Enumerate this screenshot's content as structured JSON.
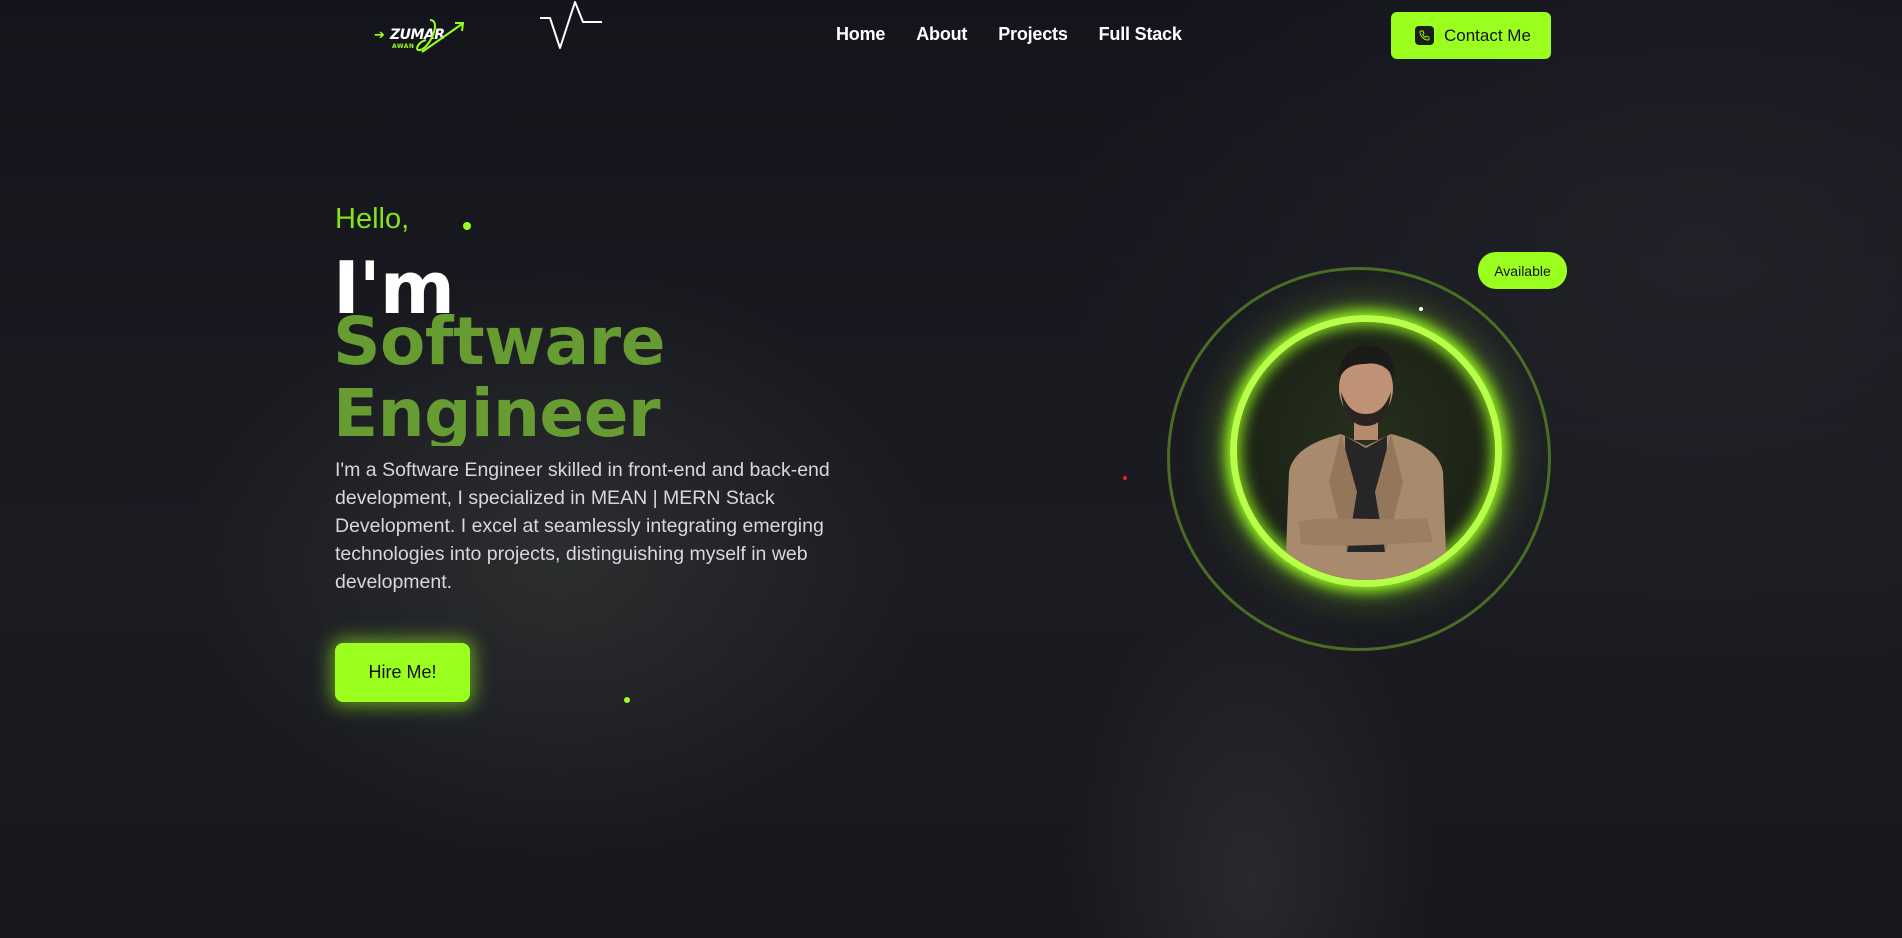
{
  "nav": {
    "logo": {
      "brand": "ZUMAR",
      "sub": "AWAN"
    },
    "menu": [
      "Home",
      "About",
      "Projects",
      "Full Stack"
    ],
    "contact_label": "Contact Me"
  },
  "hero": {
    "greeting": "Hello,",
    "intro": "I'm",
    "role_line1": "Software",
    "role_line2": "Engineer",
    "bio": "I'm a Software Engineer skilled in front-end and back-end development, I specialized in MEAN | MERN Stack Development. I excel at seamlessly integrating emerging technologies into projects, distinguishing myself in web development.",
    "hire_label": "Hire Me!"
  },
  "profile": {
    "status_badge": "Available"
  },
  "colors": {
    "accent": "#9aff1f",
    "role_text": "#669c32",
    "greeting": "#86e21c",
    "background": "#15161d"
  }
}
